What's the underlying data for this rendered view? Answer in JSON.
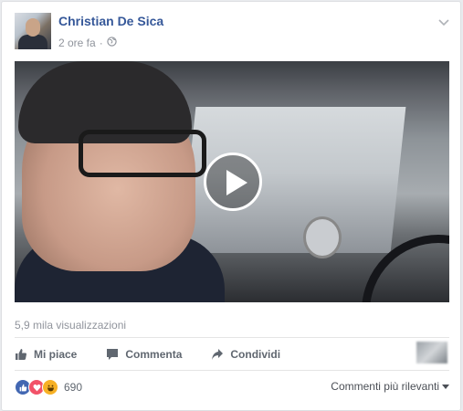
{
  "post": {
    "author": "Christian De Sica",
    "time": "2 ore fa",
    "separator": "·",
    "privacy_icon": "globe-icon",
    "menu_icon": "chevron-down-icon"
  },
  "video": {
    "views": "5,9 mila visualizzazioni",
    "play_icon": "play-icon"
  },
  "actions": {
    "like": "Mi piace",
    "comment": "Commenta",
    "share": "Condividi"
  },
  "reactions": {
    "count": "690",
    "types": [
      "like",
      "love",
      "haha"
    ],
    "colors": {
      "like": "#4267b2",
      "love": "#f25268",
      "haha": "#f7b125"
    }
  },
  "comments": {
    "sort_label": "Commenti più rilevanti"
  },
  "colors": {
    "author_link": "#365899",
    "meta_text": "#90949c",
    "action_text": "#606770"
  }
}
